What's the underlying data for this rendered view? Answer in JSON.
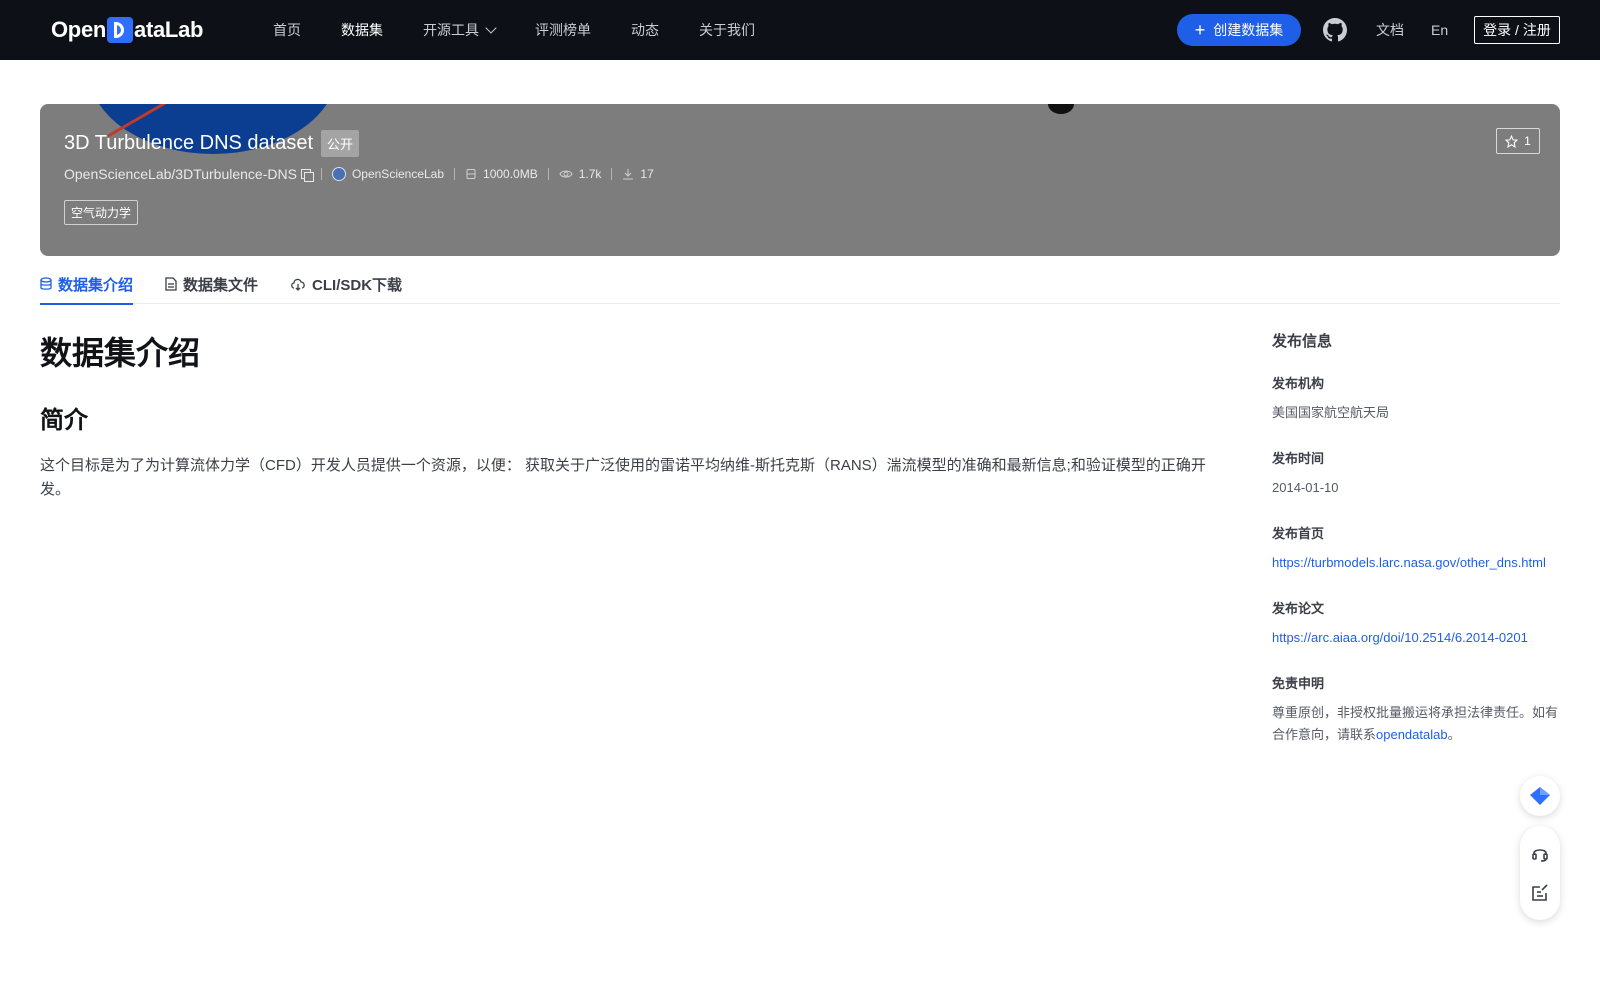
{
  "nav": {
    "logo_text_pre": "Open",
    "logo_text_post": "ataLab",
    "links": [
      "首页",
      "数据集",
      "开源工具",
      "评测榜单",
      "动态",
      "关于我们"
    ],
    "create_label": "创建数据集",
    "docs_label": "文档",
    "lang_label": "En",
    "login_label": "登录 / 注册"
  },
  "hero": {
    "title": "3D Turbulence DNS dataset",
    "visibility": "公开",
    "path": "OpenScienceLab/3DTurbulence-DNS",
    "owner": "OpenScienceLab",
    "size": "1000.0MB",
    "views": "1.7k",
    "downloads": "17",
    "tag": "空气动力学",
    "stars": "1"
  },
  "tabs": [
    "数据集介绍",
    "数据集文件",
    "CLI/SDK下载"
  ],
  "main": {
    "title": "数据集介绍",
    "section_title": "简介",
    "description": "这个目标是为了为计算流体力学（CFD）开发人员提供一个资源，以便： 获取关于广泛使用的雷诺平均纳维-斯托克斯（RANS）湍流模型的准确和最新信息;和验证模型的正确开发。"
  },
  "sidebar": {
    "heading": "发布信息",
    "org_label": "发布机构",
    "org_value": "美国国家航空航天局",
    "date_label": "发布时间",
    "date_value": "2014-01-10",
    "home_label": "发布首页",
    "home_value": "https://turbmodels.larc.nasa.gov/other_dns.html",
    "paper_label": "发布论文",
    "paper_value": "https://arc.aiaa.org/doi/10.2514/6.2014-0201",
    "disclaimer_label": "免责申明",
    "disclaimer_text": "尊重原创，非授权批量搬运将承担法律责任。如有合作意向，请联系",
    "disclaimer_link": "opendatalab",
    "disclaimer_end": "。"
  },
  "colors": {
    "nav_bg": "#0d1117",
    "accent": "#1f5fe8",
    "hero_bg": "#7d7d7d"
  },
  "icons": [
    "github-icon",
    "star-icon",
    "copy-icon",
    "database-icon",
    "eye-icon",
    "download-icon",
    "file-icon",
    "cloud-icon",
    "headset-icon",
    "edit-icon",
    "diamond-icon"
  ]
}
